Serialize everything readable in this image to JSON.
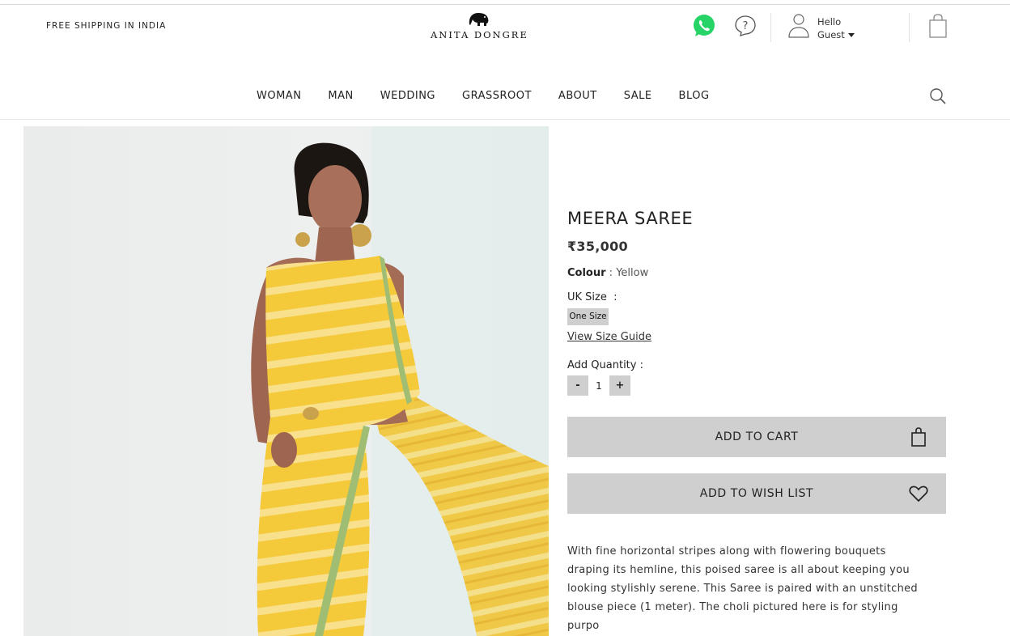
{
  "header": {
    "shipping_text": "FREE SHIPPING IN INDIA",
    "brand": "ANITA DONGRE",
    "greeting": "Hello",
    "user": "Guest"
  },
  "nav": {
    "items": [
      {
        "label": "WOMAN"
      },
      {
        "label": "MAN"
      },
      {
        "label": "WEDDING"
      },
      {
        "label": "GRASSROOT"
      },
      {
        "label": "ABOUT"
      },
      {
        "label": "SALE"
      },
      {
        "label": "BLOG"
      }
    ]
  },
  "icons": {
    "whatsapp": "whatsapp-icon",
    "help": "help-icon",
    "user": "user-icon",
    "bag": "shopping-bag-icon",
    "search": "search-icon",
    "cart_button": "bag-icon",
    "wish_button": "heart-icon"
  },
  "product": {
    "title": "MEERA SAREE",
    "price": "₹35,000",
    "colour_label": "Colour",
    "colour_sep": " : ",
    "colour_value": "Yellow",
    "size_label": "UK Size  :",
    "size_option": "One Size",
    "size_guide": "View Size Guide",
    "qty_label": "Add Quantity :",
    "qty_minus": "-",
    "qty_value": "1",
    "qty_plus": "+",
    "add_to_cart": "ADD TO CART",
    "add_to_wishlist": "ADD TO WISH LIST",
    "description": "With fine horizontal stripes along with flowering bouquets draping its hemline, this poised saree is all about keeping you looking stylishly serene. This Saree is paired with an unstitched blouse piece (1 meter). The choli pictured here is for styling purpo"
  },
  "colors": {
    "button_bg": "#cfcfcf",
    "whatsapp": "#25d366",
    "saree_yellow": "#f2c22a"
  }
}
